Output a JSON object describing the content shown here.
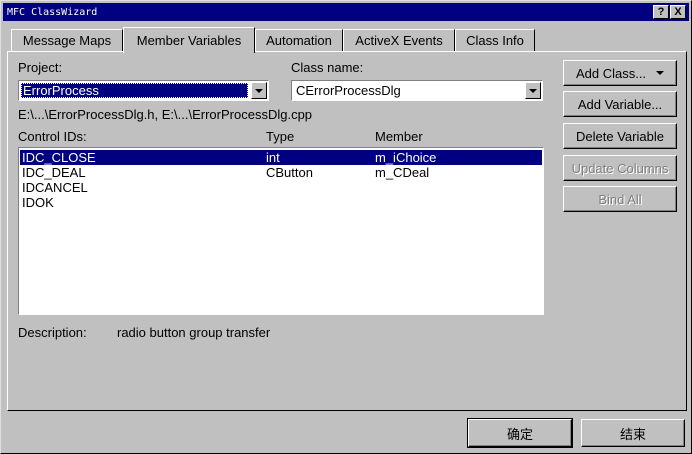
{
  "window": {
    "title": "MFC ClassWizard",
    "help_button": "?",
    "close_button": "X"
  },
  "tabs": [
    {
      "label": "Message Maps",
      "active": false
    },
    {
      "label": "Member Variables",
      "active": true
    },
    {
      "label": "Automation",
      "active": false
    },
    {
      "label": "ActiveX Events",
      "active": false
    },
    {
      "label": "Class Info",
      "active": false
    }
  ],
  "project": {
    "label": "Project:",
    "value": "ErrorProcess"
  },
  "class_name": {
    "label": "Class name:",
    "value": "CErrorProcessDlg"
  },
  "files_path": "E:\\...\\ErrorProcessDlg.h, E:\\...\\ErrorProcessDlg.cpp",
  "list": {
    "headers": {
      "control_ids": "Control IDs:",
      "type": "Type",
      "member": "Member"
    },
    "rows": [
      {
        "id": "IDC_CLOSE",
        "type": "int",
        "member": "m_iChoice",
        "selected": true
      },
      {
        "id": "IDC_DEAL",
        "type": "CButton",
        "member": "m_CDeal",
        "selected": false
      },
      {
        "id": "IDCANCEL",
        "type": "",
        "member": "",
        "selected": false
      },
      {
        "id": "IDOK",
        "type": "",
        "member": "",
        "selected": false
      }
    ]
  },
  "buttons": {
    "add_class": "Add Class...",
    "add_variable": "Add Variable...",
    "delete_variable": "Delete Variable",
    "update_columns": "Update Columns",
    "bind_all": "Bind All"
  },
  "description": {
    "label": "Description:",
    "value": "radio button group transfer"
  },
  "footer": {
    "ok": "确定",
    "cancel": "结束"
  },
  "colors": {
    "dialog_face": "#c0c0c0",
    "title_bar": "#000080",
    "selection": "#000080",
    "disabled_text": "#808080"
  }
}
